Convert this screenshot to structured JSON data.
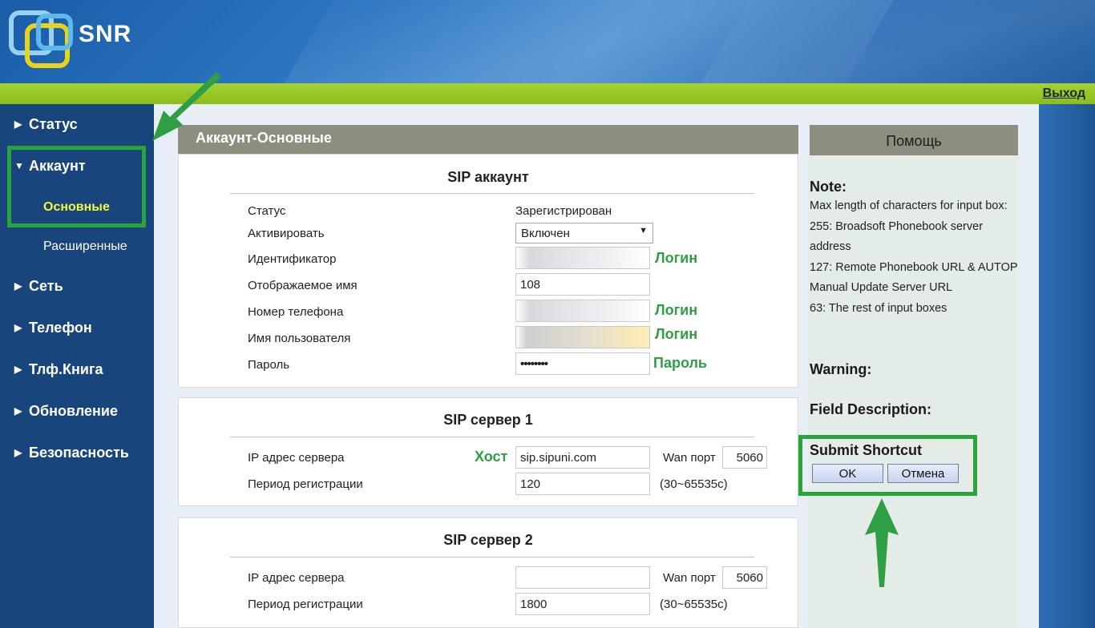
{
  "header": {
    "logo_text": "SNR",
    "logout_label": "Выход"
  },
  "sidebar": {
    "items": [
      {
        "label": "Статус",
        "arrow": "▶"
      },
      {
        "label": "Аккаунт",
        "arrow": "▼"
      },
      {
        "label": "Сеть",
        "arrow": "▶"
      },
      {
        "label": "Телефон",
        "arrow": "▶"
      },
      {
        "label": "Тлф.Книга",
        "arrow": "▶"
      },
      {
        "label": "Обновление",
        "arrow": "▶"
      },
      {
        "label": "Безопасность",
        "arrow": "▶"
      }
    ],
    "subitems": [
      {
        "label": "Основные",
        "active": true
      },
      {
        "label": "Расширенные",
        "active": false
      }
    ]
  },
  "main": {
    "title": "Аккаунт-Основные",
    "sip_account": {
      "title": "SIP аккаунт",
      "status_label": "Статус",
      "status_value": "Зарегистрирован",
      "activate_label": "Активировать",
      "activate_value": "Включен",
      "id_label": "Идентификатор",
      "id_value": "",
      "display_name_label": "Отображаемое имя",
      "display_name_value": "108",
      "phone_label": "Номер телефона",
      "phone_value": "",
      "username_label": "Имя пользователя",
      "username_value": "",
      "password_label": "Пароль",
      "password_value": "••••••••"
    },
    "sip_server1": {
      "title": "SIP сервер 1",
      "ip_label": "IP адрес сервера",
      "ip_value": "sip.sipuni.com",
      "wan_label": "Wan порт",
      "wan_value": "5060",
      "period_label": "Период регистрации",
      "period_value": "120",
      "period_range": "(30~65535с)"
    },
    "sip_server2": {
      "title": "SIP сервер 2",
      "ip_label": "IP адрес сервера",
      "ip_value": "",
      "wan_label": "Wan порт",
      "wan_value": "5060",
      "period_label": "Период регистрации",
      "period_value": "1800",
      "period_range": "(30~65535с)"
    },
    "annotations": {
      "login": "Логин",
      "password": "Пароль",
      "host": "Хост"
    }
  },
  "help": {
    "title": "Помощь",
    "note_heading": "Note:",
    "note_lines": [
      "Max length of characters for input box:",
      "255: Broadsoft Phonebook server address",
      "127: Remote Phonebook URL & AUTOP Manual Update Server URL",
      "63: The rest of input boxes"
    ],
    "warning_heading": "Warning:",
    "field_desc_heading": "Field Description:",
    "submit_heading": "Submit Shortcut",
    "ok_label": "OK",
    "cancel_label": "Отмена"
  },
  "colors": {
    "accent_green": "#29a33a",
    "header_blue": "#2e78c4",
    "sidebar_blue": "#17457c",
    "top_bar_green": "#9ccb2c",
    "title_bar_gray": "#8d8d80"
  }
}
